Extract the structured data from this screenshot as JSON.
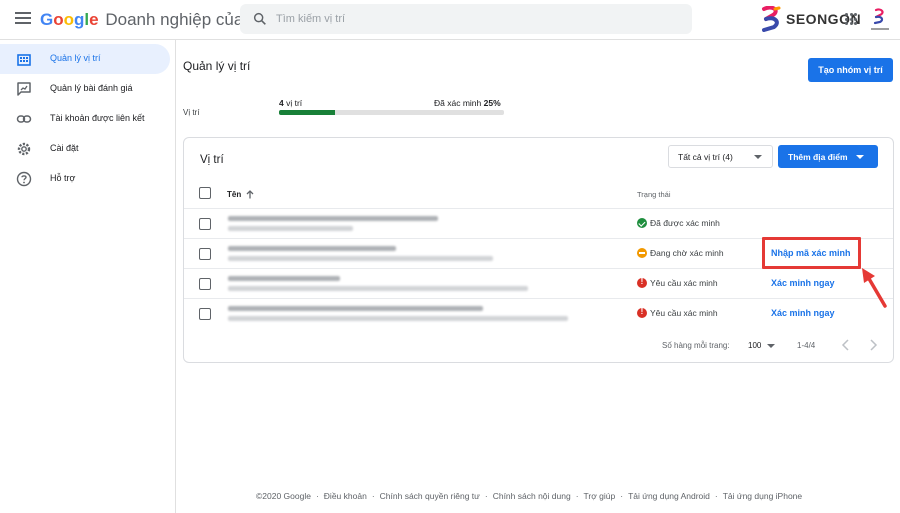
{
  "header": {
    "brand_google": "Google",
    "brand_product": "Doanh nghiệp của tôi",
    "search_placeholder": "Tìm kiếm vị trí",
    "partner_logo": "SEONGON",
    "accent": "#1a73e8"
  },
  "sidebar": {
    "items": [
      {
        "label": "Quản lý vị trí",
        "icon": "building-icon",
        "active": true
      },
      {
        "label": "Quản lý bài đánh giá",
        "icon": "review-icon",
        "active": false
      },
      {
        "label": "Tài khoản được liên kết",
        "icon": "link-icon",
        "active": false
      },
      {
        "label": "Cài đặt",
        "icon": "gear-icon",
        "active": false
      },
      {
        "label": "Hỗ trợ",
        "icon": "help-icon",
        "active": false
      }
    ]
  },
  "main": {
    "title": "Quản lý vị trí",
    "create_group_label": "Tạo nhóm vị trí",
    "summary": {
      "label": "Vị trí",
      "count_value": "4",
      "count_unit": "vị trí",
      "verified_label": "Đã xác minh",
      "verified_percent": "25%",
      "verified_fraction": 0.25
    }
  },
  "card": {
    "title": "Vị trí",
    "filter_label": "Tất cả vị trí (4)",
    "add_label": "Thêm địa điểm",
    "columns": {
      "name": "Tên",
      "status": "Trạng thái"
    },
    "rows": [
      {
        "status": "Đã được xác minh",
        "status_type": "verified",
        "action": ""
      },
      {
        "status": "Đang chờ xác minh",
        "status_type": "pending",
        "action": "Nhập mã xác minh"
      },
      {
        "status": "Yêu cầu xác minh",
        "status_type": "required",
        "action": "Xác minh ngay"
      },
      {
        "status": "Yêu cầu xác minh",
        "status_type": "required",
        "action": "Xác minh ngay"
      }
    ],
    "pagination": {
      "rows_label": "Số hàng mỗi trang:",
      "page_size": "100",
      "range": "1-4/4"
    }
  },
  "status_colors": {
    "verified": "#1e8e3e",
    "pending": "#f29900",
    "required": "#d93025"
  },
  "footer": {
    "links": [
      "©2020 Google",
      "Điều khoản",
      "Chính sách quyền riêng tư",
      "Chính sách nội dung",
      "Trợ giúp",
      "Tải ứng dụng Android",
      "Tải ứng dụng iPhone"
    ]
  }
}
